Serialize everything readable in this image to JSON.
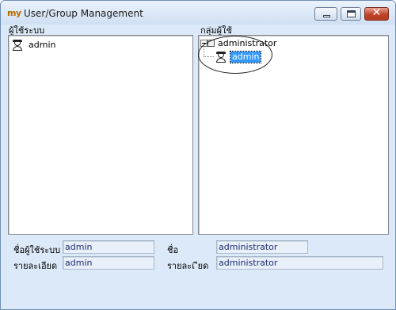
{
  "window": {
    "app_icon_text": "my",
    "title": "User/Group Management",
    "controls": {
      "minimize": "minimize",
      "maximize": "maximize",
      "close": "✕"
    }
  },
  "left_panel": {
    "label": "ผู้ใช้ระบบ",
    "items": [
      {
        "label": "admin",
        "icon": "user-icon"
      }
    ]
  },
  "right_panel": {
    "label": "กลุ่มผู้ใช้",
    "groups": [
      {
        "label": "administrator",
        "icon": "group-icon",
        "expanded": true,
        "children": [
          {
            "label": "admin",
            "icon": "user-icon",
            "selected": true
          }
        ]
      }
    ]
  },
  "fields": {
    "username_label": "ชื่อผู้ใช้ระบบ",
    "username_value": "admin",
    "user_detail_label": "รายละเอียด",
    "user_detail_value": "admin",
    "name_label": "ชื่อ",
    "name_value": "administrator",
    "group_detail_label": "รายละเ ียด",
    "group_detail_value": "administrator"
  },
  "colors": {
    "window_bg": "#dbe9f8",
    "selection": "#3399ff",
    "field_text": "#1a2a6c",
    "close_button": "#c0432a"
  }
}
